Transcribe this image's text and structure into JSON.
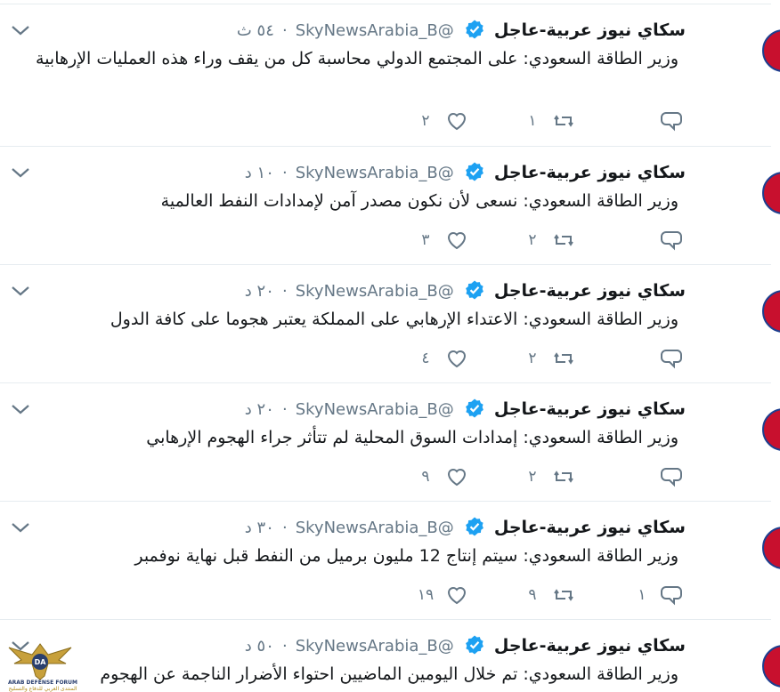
{
  "colors": {
    "accent": "#1da1f2",
    "icon_gray": "#657786",
    "divider": "#e6ecf0",
    "logo_gold": "#c7a03b"
  },
  "tweets": [
    {
      "name": "سكاي نيوز عربية-عاجل",
      "handle": "@SkyNewsArabia_B",
      "sep": "·",
      "time": "٥٤ ث",
      "text": "وزير الطاقة السعودي: على المجتمع الدولي محاسبة كل من يقف وراء هذه العمليات الإرهابية",
      "replies": "",
      "retweets": "١",
      "likes": "٢"
    },
    {
      "name": "سكاي نيوز عربية-عاجل",
      "handle": "@SkyNewsArabia_B",
      "sep": "·",
      "time": "١٠ د",
      "text": "وزير الطاقة السعودي: نسعى لأن نكون مصدر آمن لإمدادات النفط العالمية",
      "replies": "",
      "retweets": "٢",
      "likes": "٣"
    },
    {
      "name": "سكاي نيوز عربية-عاجل",
      "handle": "@SkyNewsArabia_B",
      "sep": "·",
      "time": "٢٠ د",
      "text": "وزير الطاقة السعودي: الاعتداء الإرهابي على المملكة يعتبر هجوما على كافة الدول",
      "replies": "",
      "retweets": "٢",
      "likes": "٤"
    },
    {
      "name": "سكاي نيوز عربية-عاجل",
      "handle": "@SkyNewsArabia_B",
      "sep": "·",
      "time": "٢٠ د",
      "text": "وزير الطاقة السعودي: إمدادات السوق المحلية لم تتأثر جراء الهجوم الإرهابي",
      "replies": "",
      "retweets": "٢",
      "likes": "٩"
    },
    {
      "name": "سكاي نيوز عربية-عاجل",
      "handle": "@SkyNewsArabia_B",
      "sep": "·",
      "time": "٣٠ د",
      "text": "وزير الطاقة السعودي: سيتم إنتاج 12 مليون برميل من النفط  قبل نهاية نوفمبر",
      "replies": "١",
      "retweets": "٩",
      "likes": "١٩"
    },
    {
      "name": "سكاي نيوز عربية-عاجل",
      "handle": "@SkyNewsArabia_B",
      "sep": "·",
      "time": "٥٠ د",
      "text": "وزير الطاقة السعودي: تم خلال اليومين الماضيين احتواء الأضرار الناجمة عن الهجوم",
      "replies": "",
      "retweets": "",
      "likes": ""
    }
  ],
  "watermark": {
    "name": "ARAB DEFENSE FORUM",
    "abbr": "DA",
    "tagline": "المنتدى العربي للدفاع والتسليح"
  }
}
